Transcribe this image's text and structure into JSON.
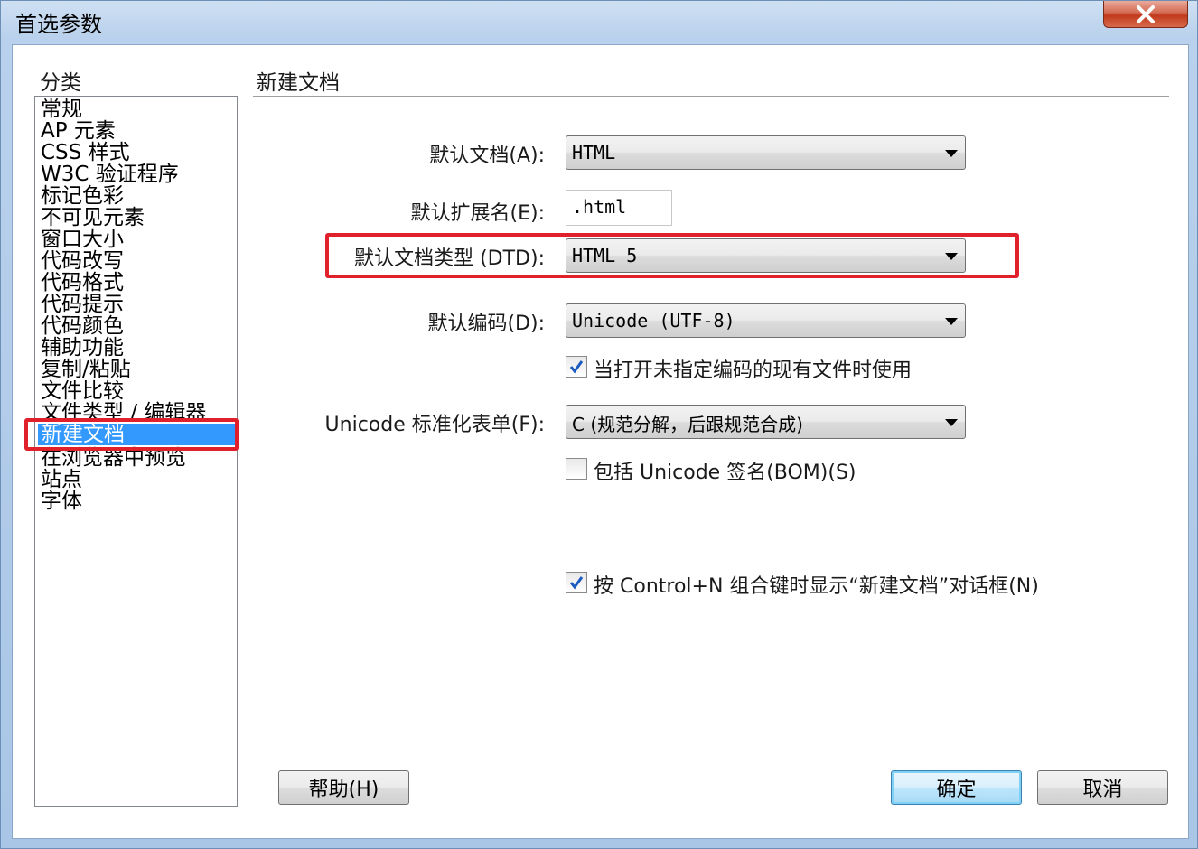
{
  "window": {
    "title": "首选参数"
  },
  "category": {
    "label": "分类",
    "items": [
      "常规",
      "AP 元素",
      "CSS 样式",
      "W3C 验证程序",
      "标记色彩",
      "不可见元素",
      "窗口大小",
      "代码改写",
      "代码格式",
      "代码提示",
      "代码颜色",
      "辅助功能",
      "复制/粘贴",
      "文件比较",
      "文件类型 / 编辑器",
      "新建文档",
      "在浏览器中预览",
      "站点",
      "字体"
    ],
    "selected": "新建文档"
  },
  "section": {
    "title": "新建文档"
  },
  "form": {
    "default_doc_label": "默认文档(A):",
    "default_doc_value": "HTML",
    "default_ext_label": "默认扩展名(E):",
    "default_ext_value": ".html",
    "dtd_label": "默认文档类型 (DTD):",
    "dtd_value": "HTML 5",
    "encoding_label": "默认编码(D):",
    "encoding_value": "Unicode (UTF-8)",
    "use_for_existing_label": "当打开未指定编码的现有文件时使用",
    "use_for_existing_checked": true,
    "normalization_label": "Unicode 标准化表单(F):",
    "normalization_value": "C (规范分解，后跟规范合成)",
    "include_bom_label": "包括 Unicode 签名(BOM)(S)",
    "include_bom_checked": false,
    "show_dialog_label": "按 Control+N 组合键时显示“新建文档”对话框(N)",
    "show_dialog_checked": true
  },
  "buttons": {
    "help": "帮助(H)",
    "ok": "确定",
    "cancel": "取消"
  },
  "colors": {
    "highlight_border": "#e0202a",
    "selection": "#3399ff",
    "check": "#1c5bbf"
  }
}
